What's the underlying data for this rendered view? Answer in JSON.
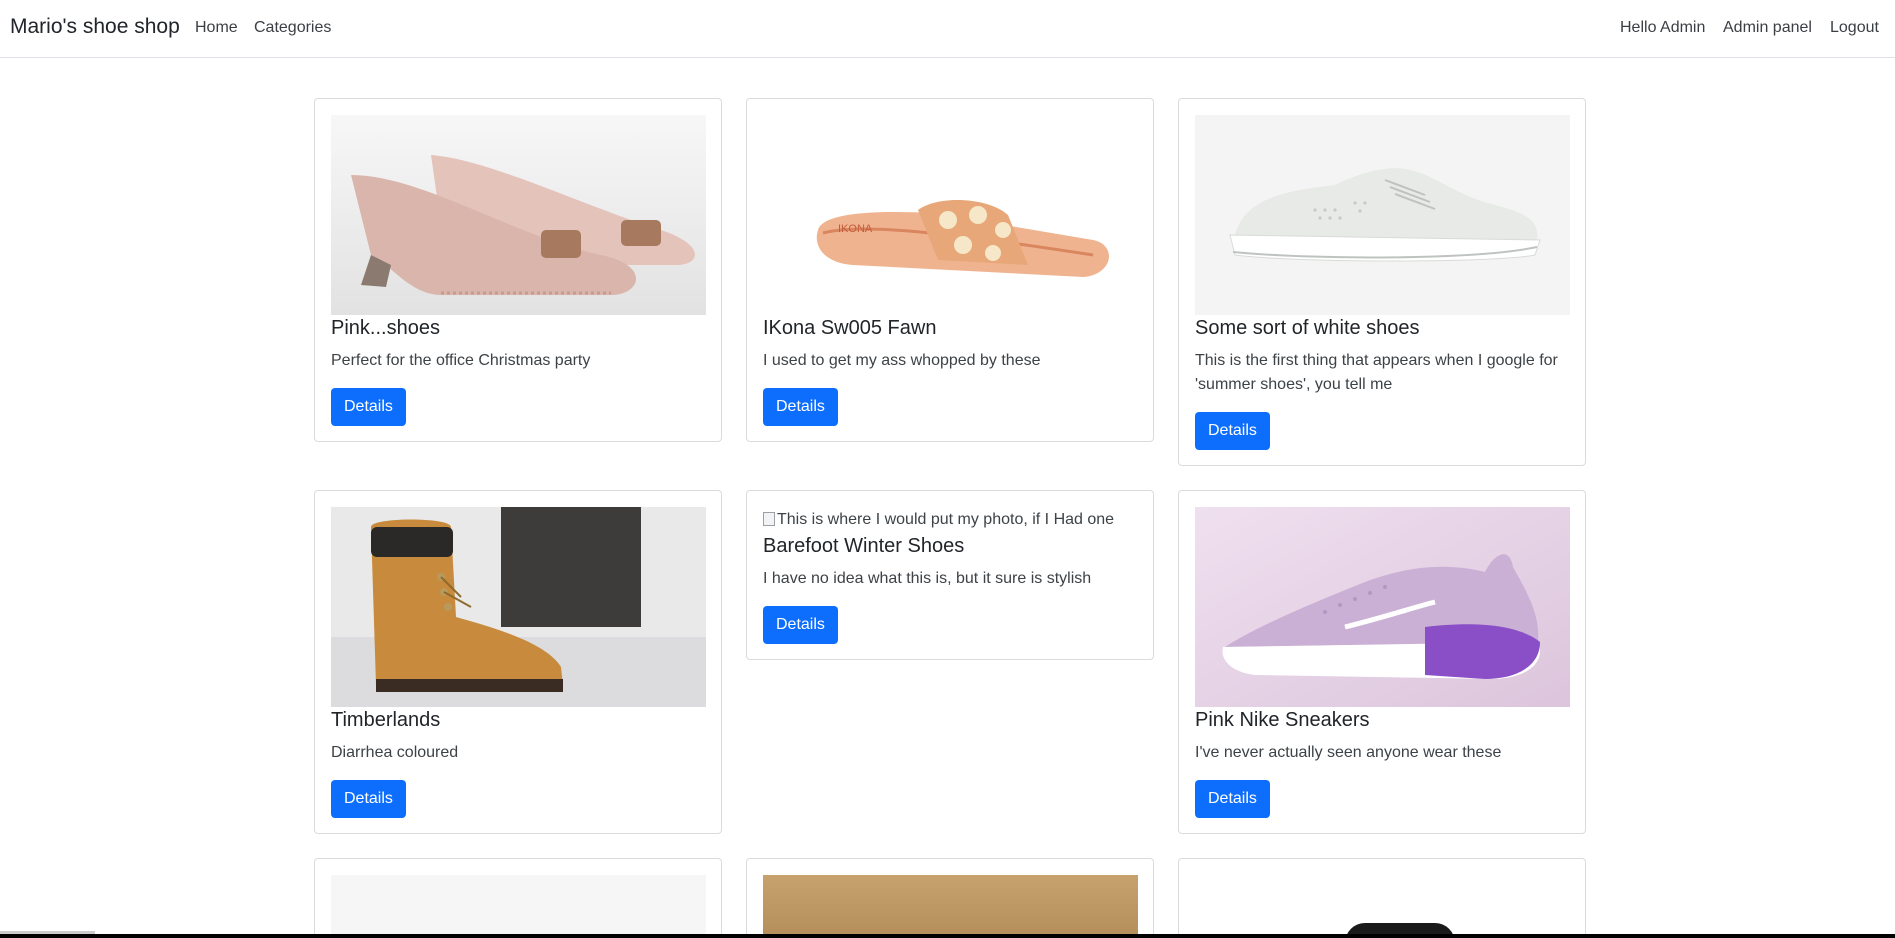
{
  "nav": {
    "brand": "Mario's shoe shop",
    "home": "Home",
    "categories": "Categories",
    "hello": "Hello Admin",
    "admin_panel": "Admin panel",
    "logout": "Logout"
  },
  "products": [
    {
      "title": "Pink...shoes",
      "description": "Perfect for the office Christmas party",
      "button": "Details",
      "image": "pink-heels"
    },
    {
      "title": "IKona Sw005 Fawn",
      "description": "I used to get my ass whopped by these",
      "button": "Details",
      "image": "sandal"
    },
    {
      "title": "Some sort of white shoes",
      "description": "This is the first thing that appears when I google for 'summer shoes', you tell me",
      "button": "Details",
      "image": "white-sneaker"
    },
    {
      "title": "Timberlands",
      "description": "Diarrhea coloured",
      "button": "Details",
      "image": "boots"
    },
    {
      "title": "Barefoot Winter Shoes",
      "description": "I have no idea what this is, but it sure is stylish",
      "button": "Details",
      "image_alt": "This is where I would put my photo, if I Had one"
    },
    {
      "title": "Pink Nike Sneakers",
      "description": "I've never actually seen anyone wear these",
      "button": "Details",
      "image": "pink-nike"
    }
  ],
  "colors": {
    "primary": "#0d6efd",
    "border": "#dee2e6"
  }
}
